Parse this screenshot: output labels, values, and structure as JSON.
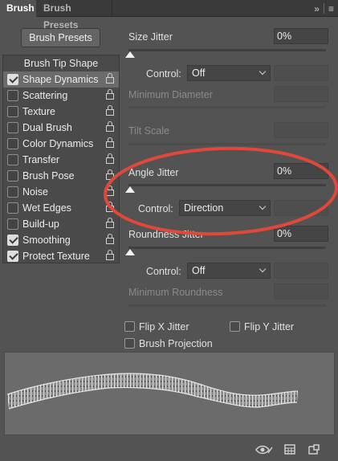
{
  "tabs": {
    "active": "Brush",
    "inactive": "Brush Presets"
  },
  "header_icons": [
    "double-chevron-icon",
    "menu-icon"
  ],
  "presets_button": "Brush Presets",
  "list": {
    "header": "Brush Tip Shape",
    "items": [
      {
        "label": "Shape Dynamics",
        "checked": true,
        "selected": true
      },
      {
        "label": "Scattering",
        "checked": false
      },
      {
        "label": "Texture",
        "checked": false
      },
      {
        "label": "Dual Brush",
        "checked": false
      },
      {
        "label": "Color Dynamics",
        "checked": false
      },
      {
        "label": "Transfer",
        "checked": false
      },
      {
        "label": "Brush Pose",
        "checked": false
      },
      {
        "label": "Noise",
        "checked": false
      },
      {
        "label": "Wet Edges",
        "checked": false
      },
      {
        "label": "Build-up",
        "checked": false
      },
      {
        "label": "Smoothing",
        "checked": true
      },
      {
        "label": "Protect Texture",
        "checked": true
      }
    ]
  },
  "size_jitter": {
    "label": "Size Jitter",
    "value": "0%",
    "control_label": "Control:",
    "control_value": "Off",
    "min_label": "Minimum Diameter",
    "tilt_label": "Tilt Scale"
  },
  "angle_jitter": {
    "label": "Angle Jitter",
    "value": "0%",
    "control_label": "Control:",
    "control_value": "Direction"
  },
  "roundness_jitter": {
    "label": "Roundness Jitter",
    "value": "0%",
    "control_label": "Control:",
    "control_value": "Off",
    "min_label": "Minimum Roundness"
  },
  "flip": {
    "x_label": "Flip X Jitter",
    "y_label": "Flip Y Jitter",
    "projection_label": "Brush Projection"
  },
  "annotation_color": "#e0483a",
  "bottom_icons": [
    "eye-icon",
    "grid-icon",
    "new-preset-icon"
  ]
}
